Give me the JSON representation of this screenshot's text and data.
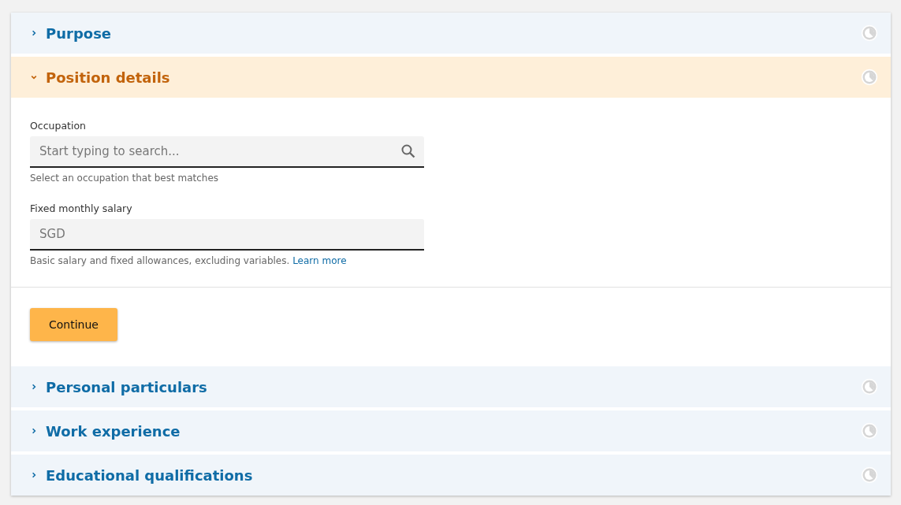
{
  "sections": [
    {
      "title": "Purpose",
      "expanded": false
    },
    {
      "title": "Position details",
      "expanded": true,
      "fields": [
        {
          "kind": "search",
          "label": "Occupation",
          "placeholder": "Start typing to search...",
          "help": "Select an occupation that best matches"
        },
        {
          "kind": "text",
          "label": "Fixed monthly salary",
          "placeholder": "SGD",
          "help": "Basic salary and fixed allowances, excluding variables.",
          "link": "Learn more"
        }
      ],
      "button": "Continue"
    },
    {
      "title": "Personal particulars",
      "expanded": false
    },
    {
      "title": "Work experience",
      "expanded": false
    },
    {
      "title": "Educational qualifications",
      "expanded": false
    }
  ]
}
